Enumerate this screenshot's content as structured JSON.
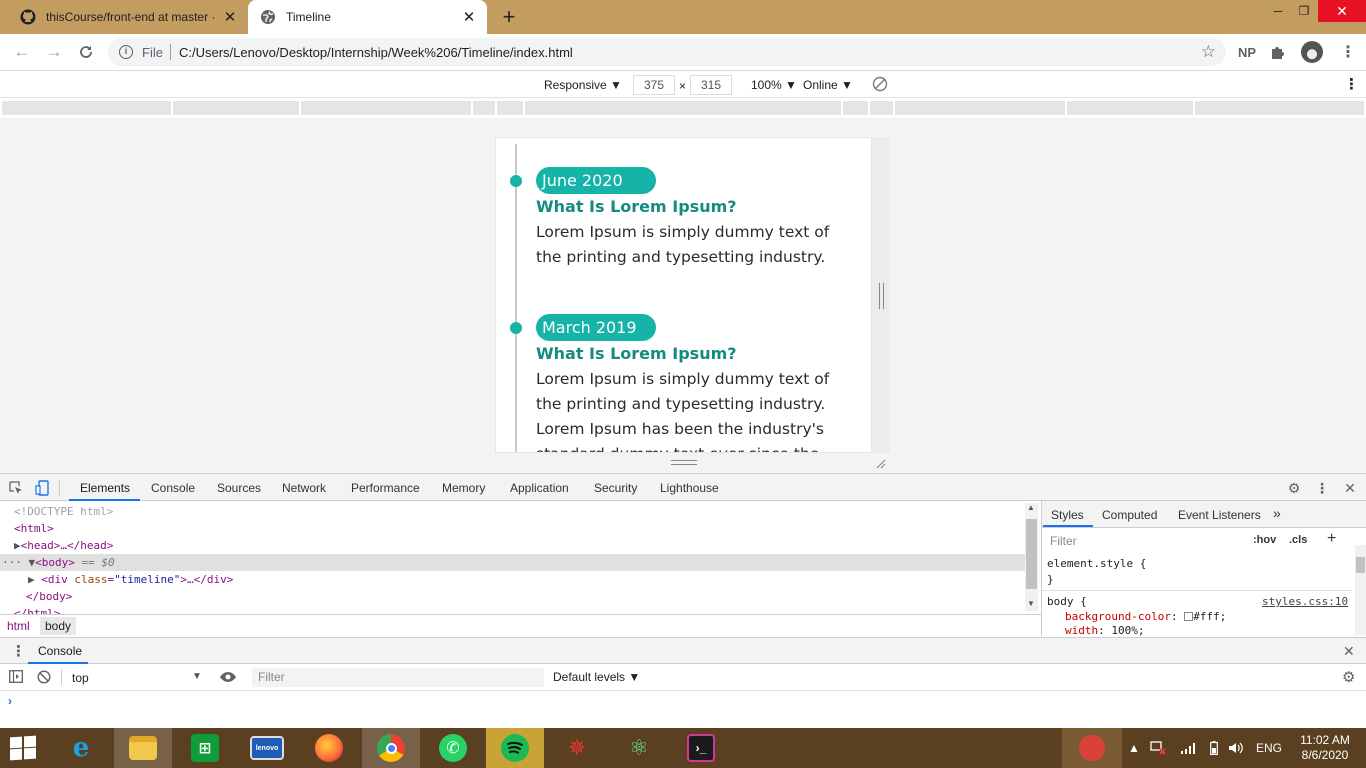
{
  "browser": {
    "tabs": [
      {
        "label": "thisCourse/front-end at master ·",
        "icon": "github-icon"
      },
      {
        "label": "Timeline",
        "icon": "globe-icon"
      }
    ],
    "new_tab_label": "+",
    "address": {
      "file_label": "File",
      "url": "C:/Users/Lenovo/Desktop/Internship/Week%206/Timeline/index.html"
    },
    "profile_initials": "NP"
  },
  "device_toolbar": {
    "mode": "Responsive ▼",
    "width": "375",
    "times": "×",
    "height": "315",
    "zoom": "100% ▼",
    "network": "Online ▼"
  },
  "timeline": {
    "entries": [
      {
        "date": "June 2020",
        "title": "What Is Lorem Ipsum?",
        "text": "Lorem Ipsum is simply dummy text of the printing and typesetting industry."
      },
      {
        "date": "March 2019",
        "title": "What Is Lorem Ipsum?",
        "text": "Lorem Ipsum is simply dummy text of the printing and typesetting industry. Lorem Ipsum has been the industry's standard dummy text ever since the"
      }
    ],
    "accent_color": "#16b3a8",
    "title_color": "#168b7d"
  },
  "devtools": {
    "tabs": [
      "Elements",
      "Console",
      "Sources",
      "Network",
      "Performance",
      "Memory",
      "Application",
      "Security",
      "Lighthouse"
    ],
    "active_tab": "Elements",
    "dom": {
      "doctype": "<!DOCTYPE html>",
      "html_open": "<html>",
      "head": "<head>…</head>",
      "body_open": "<body>",
      "body_marker": "== $0",
      "div_open_tag": "<div ",
      "div_attr": "class",
      "div_eq": "=",
      "div_val": "\"timeline\"",
      "div_close": ">…</div>",
      "body_close": "</body>",
      "html_close": "</html>",
      "ellipsis": "···"
    },
    "breadcrumbs": [
      "html",
      "body"
    ],
    "styles": {
      "tabs": [
        "Styles",
        "Computed",
        "Event Listeners",
        "»"
      ],
      "filter_placeholder": "Filter",
      "hov": ":hov",
      "cls": ".cls",
      "plus": "+",
      "element_style_open": "element.style {",
      "element_style_close": "}",
      "rule_selector": "body {",
      "rule_source": "styles.css:10",
      "prop1_name": "background-color",
      "prop1_value": "#fff;",
      "prop2_name": "width",
      "prop2_value": "100%;"
    },
    "drawer": {
      "tab": "Console",
      "context": "top",
      "filter_placeholder": "Filter",
      "levels": "Default levels ▼",
      "prompt": "›"
    }
  },
  "taskbar": {
    "apps": [
      "internet-explorer",
      "file-explorer",
      "microsoft-store",
      "lenovo-vantage",
      "firefox",
      "chrome",
      "whatsapp",
      "spotify",
      "spider-app",
      "atom",
      "terminal"
    ],
    "language": "ENG",
    "time": "11:02 AM",
    "date": "8/6/2020"
  }
}
